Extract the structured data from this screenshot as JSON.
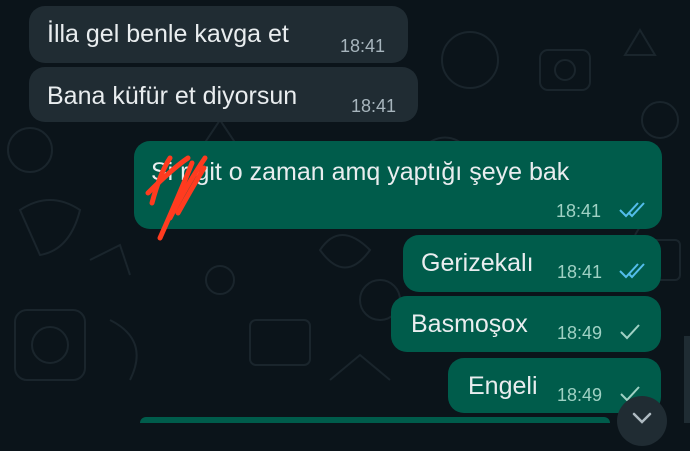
{
  "messages": [
    {
      "direction": "incoming",
      "text": "İlla gel benle kavga et",
      "time": "18:41"
    },
    {
      "direction": "incoming",
      "text": "Bana küfür et diyorsun",
      "time": "18:41"
    },
    {
      "direction": "outgoing",
      "text": "Si  r git o zaman amq yaptığı şeye bak",
      "time": "18:41",
      "status": "read"
    },
    {
      "direction": "outgoing",
      "text": "Gerizekalı",
      "time": "18:41",
      "status": "read"
    },
    {
      "direction": "outgoing",
      "text": "Basmoşox",
      "time": "18:49",
      "status": "sent"
    },
    {
      "direction": "outgoing",
      "text": "Engeli",
      "time": "18:49",
      "status": "sent"
    }
  ],
  "colors": {
    "background": "#0b141a",
    "incoming_bubble": "#202c33",
    "outgoing_bubble": "#005c4b",
    "read_tick": "#53bdeb",
    "sent_tick": "#9fd1c4",
    "scribble": "#ff3b1f"
  },
  "icons": {
    "read": "double-check-icon",
    "sent": "single-check-icon",
    "scroll": "chevron-down-icon"
  }
}
